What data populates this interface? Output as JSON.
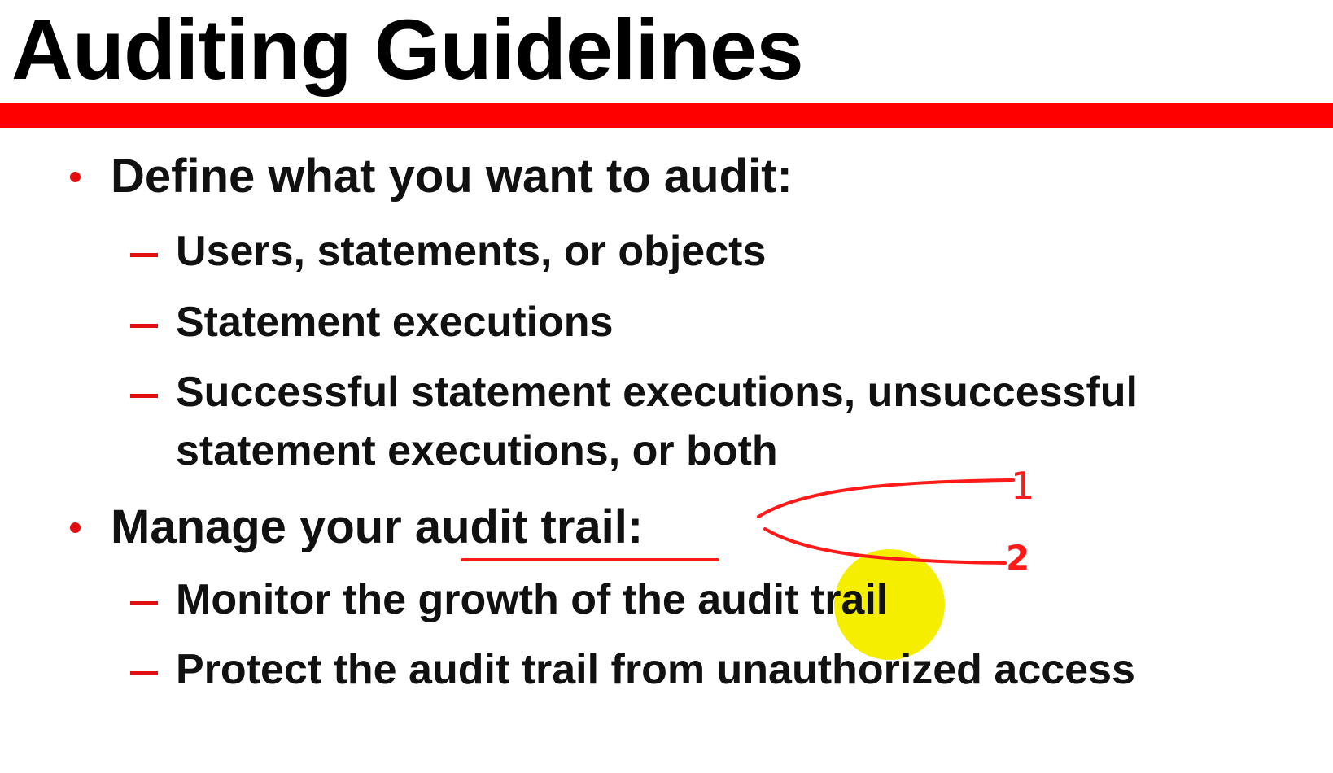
{
  "slide": {
    "title": "Auditing Guidelines",
    "bullets": [
      {
        "text": "Define what you want to audit:",
        "subitems": [
          "Users, statements, or objects",
          "Statement executions",
          "Successful statement executions, unsuccessful",
          "statement executions, or both"
        ]
      },
      {
        "text_prefix": "Manage your ",
        "text_highlight": "audit trail:",
        "subitems": [
          "Monitor the growth of the audit trail",
          "Protect the audit trail from unauthorized access"
        ]
      }
    ]
  },
  "annotations": {
    "ink_color": "#ff1a1a",
    "cursor_highlight_color": "#f5ee00",
    "handwritten_marks": [
      "1",
      "2"
    ]
  },
  "colors": {
    "accent_bar": "#ff0000",
    "bullet": "#e01010",
    "text": "#111111"
  }
}
